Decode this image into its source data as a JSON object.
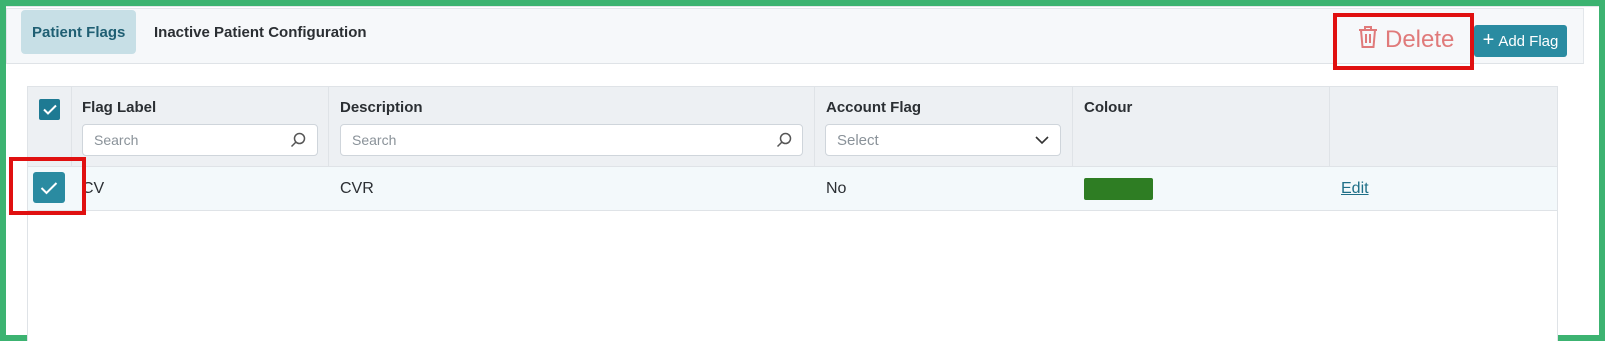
{
  "tabs": [
    {
      "label": "Patient Flags",
      "active": true
    },
    {
      "label": "Inactive Patient Configuration",
      "active": false
    }
  ],
  "toolbar": {
    "delete_label": "Delete",
    "add_label": "Add Flag",
    "delete_icon": "trash-icon",
    "add_icon": "plus-icon"
  },
  "table": {
    "columns": [
      "Flag Label",
      "Description",
      "Account Flag",
      "Colour",
      ""
    ],
    "filters": {
      "flag_label_placeholder": "Search",
      "description_placeholder": "Search",
      "account_flag_placeholder": "Select"
    },
    "header_checked": true,
    "rows": [
      {
        "checked": true,
        "flag_label": "CV",
        "description": "CVR",
        "account_flag": "No",
        "colour": "#2e7d23",
        "action": "Edit"
      }
    ]
  },
  "colors": {
    "accent": "#2a8ba1",
    "delete": "#e07a7a",
    "highlight_border": "#e01010",
    "frame_border": "#3cb371"
  }
}
